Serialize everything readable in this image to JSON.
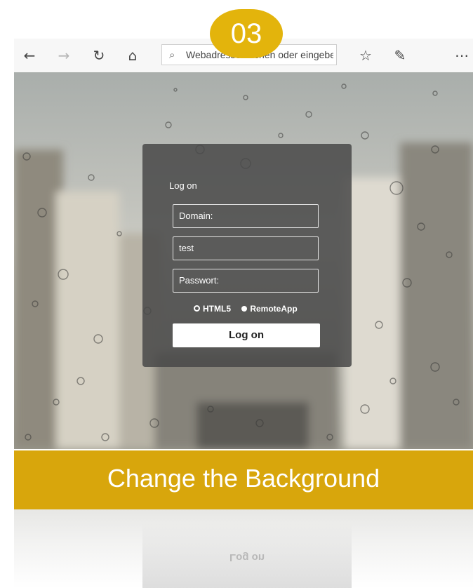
{
  "badge": {
    "number": "03"
  },
  "browser": {
    "address_placeholder": "Webadresse suchen oder eingeben",
    "icons": [
      "back-arrow-icon",
      "forward-arrow-icon",
      "refresh-icon",
      "home-icon",
      "search-icon",
      "favorites-icon",
      "pen-icon",
      "more-icon"
    ]
  },
  "login": {
    "title": "Log on",
    "domain_placeholder": "Domain:",
    "user_value": "test",
    "password_placeholder": "Passwort:",
    "option_html5": "HTML5",
    "option_remoteapp": "RemoteApp",
    "selected_option": "HTML5",
    "button_label": "Log on"
  },
  "banner": {
    "text": "Change the Background"
  },
  "colors": {
    "accent": "#d8a60c",
    "badge": "#e3b40c",
    "panel": "#484848"
  }
}
